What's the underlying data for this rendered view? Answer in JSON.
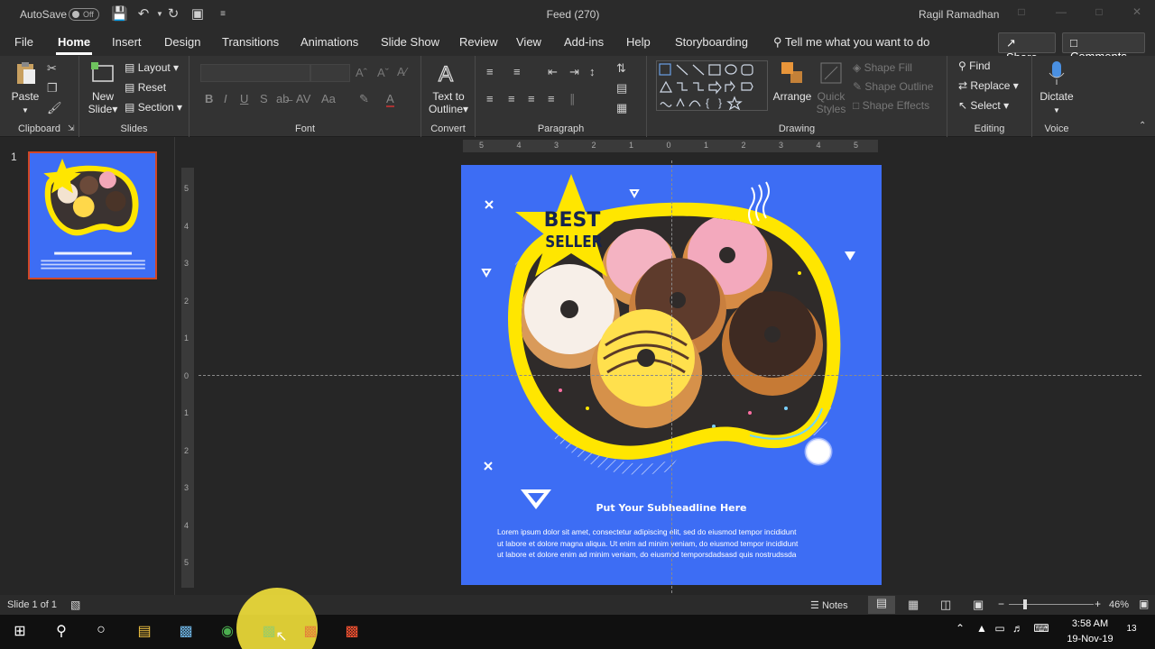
{
  "titlebar": {
    "autosave_label": "AutoSave",
    "autosave_state": "Off",
    "doc_title": "Feed (270)",
    "user": "Ragil Ramadhan"
  },
  "tabs": [
    "File",
    "Home",
    "Insert",
    "Design",
    "Transitions",
    "Animations",
    "Slide Show",
    "Review",
    "View",
    "Add-ins",
    "Help",
    "Storyboarding"
  ],
  "active_tab": "Home",
  "tell_me": "Tell me what you want to do",
  "share_label": "Share",
  "comments_label": "Comments",
  "ribbon": {
    "clipboard": {
      "label": "Clipboard",
      "paste": "Paste"
    },
    "slides": {
      "label": "Slides",
      "new_slide_1": "New",
      "new_slide_2": "Slide",
      "layout": "Layout",
      "reset": "Reset",
      "section": "Section"
    },
    "font": {
      "label": "Font",
      "bold": "B",
      "italic": "I",
      "underline": "U",
      "shadow": "S",
      "case": "Aa"
    },
    "convert": {
      "label": "Convert",
      "text_to_outline_1": "Text to",
      "text_to_outline_2": "Outline"
    },
    "paragraph": {
      "label": "Paragraph"
    },
    "drawing": {
      "label": "Drawing",
      "arrange": "Arrange",
      "quick_styles_1": "Quick",
      "quick_styles_2": "Styles",
      "shape_fill": "Shape Fill",
      "shape_outline": "Shape Outline",
      "shape_effects": "Shape Effects"
    },
    "editing": {
      "label": "Editing",
      "find": "Find",
      "replace": "Replace",
      "select": "Select"
    },
    "voice": {
      "label": "Voice",
      "dictate": "Dictate"
    }
  },
  "thumbnail": {
    "number": "1"
  },
  "rulers": {
    "h": [
      "5",
      "4",
      "3",
      "2",
      "1",
      "0",
      "1",
      "2",
      "3",
      "4",
      "5"
    ],
    "v": [
      "5",
      "4",
      "3",
      "2",
      "1",
      "0",
      "1",
      "2",
      "3",
      "4",
      "5"
    ]
  },
  "slide": {
    "badge_1": "BEST",
    "badge_2": "SELLER",
    "subheadline": "Put Your Subheadline Here",
    "body": [
      "Lorem ipsum dolor sit amet, consectetur adipiscing elit, sed do eiusmod tempor incididunt",
      "ut labore et dolore magna aliqua. Ut enim ad minim veniam, do eiusmod tempor incididunt",
      "ut labore et dolore enim ad minim veniam, do eiusmod temporsdadsasd quis nostrudssda"
    ]
  },
  "statusbar": {
    "slide_info": "Slide 1 of 1",
    "notes": "Notes",
    "zoom": "46%"
  },
  "taskbar": {
    "time": "3:58 AM",
    "date": "19-Nov-19",
    "notif_count": "13"
  },
  "colors": {
    "accent": "#d24726",
    "slide_bg": "#3d6df4",
    "badge": "#ffe600"
  }
}
